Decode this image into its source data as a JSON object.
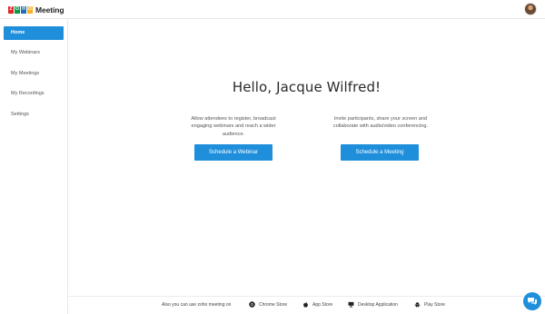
{
  "header": {
    "brand": "Meeting",
    "logo_letters": [
      "Z",
      "O",
      "H",
      "O"
    ],
    "logo_colors": [
      "#e42527",
      "#089949",
      "#226db4",
      "#f9b21d"
    ]
  },
  "sidebar": {
    "items": [
      {
        "label": "Home",
        "active": true
      },
      {
        "label": "My Webinars",
        "active": false
      },
      {
        "label": "My Meetings",
        "active": false
      },
      {
        "label": "My Recordings",
        "active": false
      },
      {
        "label": "Settings",
        "active": false
      }
    ]
  },
  "main": {
    "greeting": "Hello, Jacque Wilfred!",
    "webinar_desc": "Allow attendees to register, broadcast engaging webinars and reach a wider audience.",
    "meeting_desc": "Invite participants, share your screen and collaborate with audio/video conferencing.",
    "webinar_button": "Schedule a Webinar",
    "meeting_button": "Schedule a Meeting"
  },
  "footer": {
    "text": "Also you can use zoho meeting on",
    "links": [
      {
        "label": "Chrome Store",
        "icon": "chrome-icon"
      },
      {
        "label": "App Store",
        "icon": "apple-icon"
      },
      {
        "label": "Desktop Application",
        "icon": "monitor-icon"
      },
      {
        "label": "Play Store",
        "icon": "android-icon"
      }
    ]
  },
  "colors": {
    "accent": "#1f8fdc"
  }
}
